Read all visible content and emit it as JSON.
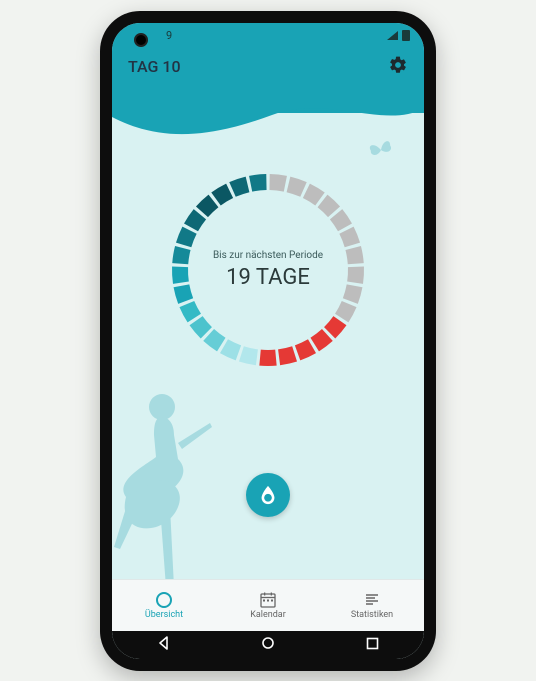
{
  "status": {
    "left_text": "9"
  },
  "header": {
    "title": "TAG 10"
  },
  "ring": {
    "subtitle": "Bis zur nächsten Periode",
    "main": "19 TAGE",
    "segments": [
      "#bdbdbd",
      "#bdbdbd",
      "#bdbdbd",
      "#bdbdbd",
      "#bdbdbd",
      "#bdbdbd",
      "#bdbdbd",
      "#bdbdbd",
      "#bdbdbd",
      "#bdbdbd",
      "#e53935",
      "#e53935",
      "#e53935",
      "#e53935",
      "#e53935",
      "#b2e7ec",
      "#9ce0e6",
      "#66cdd6",
      "#4cc3cd",
      "#33bac5",
      "#19a3b5",
      "#19a3b5",
      "#148a99",
      "#117987",
      "#0e6875",
      "#0b5763",
      "#0b5763",
      "#0e6875",
      "#117987"
    ]
  },
  "nav": {
    "items": [
      {
        "label": "Übersicht",
        "icon": "overview",
        "active": true
      },
      {
        "label": "Kalendar",
        "icon": "calendar",
        "active": false
      },
      {
        "label": "Statistiken",
        "icon": "stats",
        "active": false
      }
    ]
  }
}
